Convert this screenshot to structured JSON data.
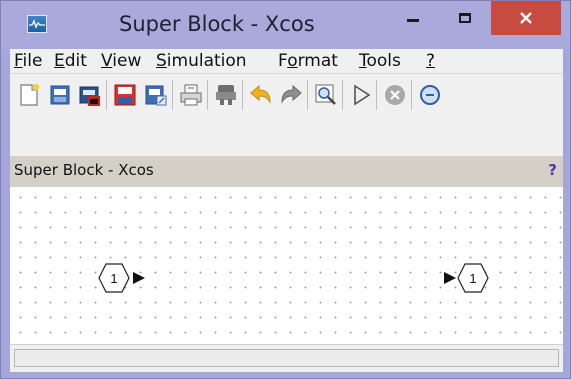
{
  "window": {
    "title": "Super Block - Xcos",
    "icons": {
      "app": "xcos-app-icon",
      "minimize": "minimize-icon",
      "maximize": "maximize-icon",
      "close": "close-icon"
    },
    "close_color": "#c74b40"
  },
  "menu": {
    "items": [
      {
        "label": "File",
        "mnemonic": "F",
        "rest": "ile"
      },
      {
        "label": "Edit",
        "mnemonic": "E",
        "rest": "dit"
      },
      {
        "label": "View",
        "mnemonic": "V",
        "rest": "iew"
      },
      {
        "label": "Simulation",
        "mnemonic": "S",
        "rest": "imulation"
      },
      {
        "label": "Format",
        "pre": "F",
        "mnemonic": "o",
        "rest": "rmat"
      },
      {
        "label": "Tools",
        "mnemonic": "T",
        "rest": "ools"
      },
      {
        "label": "?",
        "mnemonic": "?",
        "rest": ""
      }
    ]
  },
  "toolbar": {
    "tools": [
      "new-diagram-icon",
      "open-icon",
      "open-in-scilab-icon",
      "save-icon",
      "save-as-icon",
      "print-icon",
      "export-icon",
      "undo-icon",
      "redo-icon",
      "zoom-in-icon",
      "start-icon",
      "stop-icon",
      "zoom-out-icon"
    ]
  },
  "header": {
    "title": "Super Block - Xcos",
    "help": "?"
  },
  "canvas": {
    "input_port": {
      "number": "1",
      "type": "input"
    },
    "output_port": {
      "number": "1",
      "type": "output"
    }
  },
  "status": {
    "text": ""
  }
}
